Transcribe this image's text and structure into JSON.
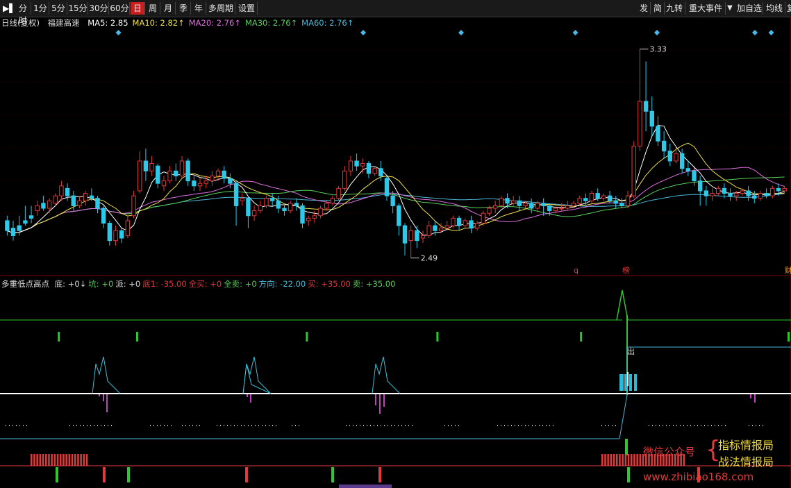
{
  "toolbar": {
    "icon": "expand-arrow-icon",
    "periods": [
      "分时",
      "1分",
      "5分",
      "15分",
      "30分",
      "60分",
      "日",
      "周",
      "月",
      "季",
      "年",
      "多周期",
      "设置"
    ],
    "active_period": "日",
    "right_buttons": [
      "发",
      "简",
      "九转",
      "重大事件",
      "加自选",
      "均线",
      "复"
    ]
  },
  "header": {
    "label": "日线(复权)",
    "name": "福建高速",
    "ma": [
      {
        "label": "MA5:",
        "value": "2.85",
        "color": "#ffffff",
        "arrow": ""
      },
      {
        "label": "MA10:",
        "value": "2.82",
        "color": "#f0e04a",
        "arrow": "↑"
      },
      {
        "label": "MA20:",
        "value": "2.76",
        "color": "#e070e0",
        "arrow": "↑"
      },
      {
        "label": "MA30:",
        "value": "2.76",
        "color": "#5ad05a",
        "arrow": "↑"
      },
      {
        "label": "MA60:",
        "value": "2.76",
        "color": "#4ab8d8",
        "arrow": "↑"
      }
    ]
  },
  "indicator": {
    "name": "多重低点高点",
    "segments": [
      {
        "text": "底: +0↓",
        "color": "#dddddd"
      },
      {
        "text": "坑: +0",
        "color": "#5ad05a"
      },
      {
        "text": "派: +0",
        "color": "#dddddd"
      },
      {
        "text": "底1: -35.00",
        "color": "#e03a3a"
      },
      {
        "text": "全买: +0",
        "color": "#e03a3a"
      },
      {
        "text": "全卖: +0",
        "color": "#5ad05a"
      },
      {
        "text": "方向: -22.00",
        "color": "#4ab8d8"
      },
      {
        "text": "买: +35.00",
        "color": "#e03a3a"
      },
      {
        "text": "卖: +35.00",
        "color": "#5ad05a"
      }
    ]
  },
  "chart_data": {
    "type": "candlestick",
    "price_high_label": "3.33",
    "price_low_label": "2.49",
    "marker_labels": [
      "q",
      "榜",
      "财"
    ],
    "indicator_glyph": "出",
    "ohlc": [
      [
        2.64,
        2.66,
        2.6,
        2.58
      ],
      [
        2.61,
        2.64,
        2.58,
        2.56
      ],
      [
        2.62,
        2.66,
        2.6,
        2.58
      ],
      [
        2.64,
        2.7,
        2.63,
        2.62
      ],
      [
        2.66,
        2.7,
        2.65,
        2.63
      ],
      [
        2.68,
        2.72,
        2.7,
        2.66
      ],
      [
        2.71,
        2.74,
        2.69,
        2.68
      ],
      [
        2.69,
        2.73,
        2.72,
        2.67
      ],
      [
        2.71,
        2.75,
        2.74,
        2.7
      ],
      [
        2.74,
        2.8,
        2.78,
        2.72
      ],
      [
        2.77,
        2.79,
        2.74,
        2.72
      ],
      [
        2.74,
        2.76,
        2.7,
        2.68
      ],
      [
        2.7,
        2.74,
        2.72,
        2.69
      ],
      [
        2.72,
        2.76,
        2.75,
        2.7
      ],
      [
        2.74,
        2.77,
        2.73,
        2.72
      ],
      [
        2.73,
        2.74,
        2.69,
        2.67
      ],
      [
        2.69,
        2.7,
        2.63,
        2.61
      ],
      [
        2.63,
        2.64,
        2.56,
        2.54
      ],
      [
        2.56,
        2.62,
        2.6,
        2.54
      ],
      [
        2.6,
        2.61,
        2.57,
        2.55
      ],
      [
        2.58,
        2.66,
        2.64,
        2.57
      ],
      [
        2.66,
        2.76,
        2.74,
        2.65
      ],
      [
        2.76,
        2.92,
        2.88,
        2.75
      ],
      [
        2.88,
        2.93,
        2.84,
        2.8
      ],
      [
        2.84,
        2.9,
        2.87,
        2.82
      ],
      [
        2.86,
        2.87,
        2.79,
        2.77
      ],
      [
        2.78,
        2.82,
        2.8,
        2.76
      ],
      [
        2.8,
        2.86,
        2.84,
        2.79
      ],
      [
        2.84,
        2.87,
        2.82,
        2.8
      ],
      [
        2.82,
        2.9,
        2.88,
        2.81
      ],
      [
        2.88,
        2.89,
        2.8,
        2.78
      ],
      [
        2.8,
        2.82,
        2.78,
        2.76
      ],
      [
        2.78,
        2.81,
        2.79,
        2.76
      ],
      [
        2.79,
        2.82,
        2.8,
        2.77
      ],
      [
        2.8,
        2.84,
        2.82,
        2.78
      ],
      [
        2.82,
        2.85,
        2.84,
        2.8
      ],
      [
        2.84,
        2.86,
        2.81,
        2.79
      ],
      [
        2.81,
        2.83,
        2.79,
        2.77
      ],
      [
        2.79,
        2.8,
        2.7,
        2.62
      ],
      [
        2.72,
        2.75,
        2.73,
        2.7
      ],
      [
        2.73,
        2.74,
        2.66,
        2.61
      ],
      [
        2.66,
        2.7,
        2.68,
        2.64
      ],
      [
        2.68,
        2.72,
        2.7,
        2.67
      ],
      [
        2.7,
        2.74,
        2.73,
        2.69
      ],
      [
        2.73,
        2.75,
        2.72,
        2.7
      ],
      [
        2.72,
        2.74,
        2.69,
        2.67
      ],
      [
        2.69,
        2.71,
        2.68,
        2.66
      ],
      [
        2.68,
        2.72,
        2.71,
        2.67
      ],
      [
        2.71,
        2.73,
        2.7,
        2.68
      ],
      [
        2.7,
        2.71,
        2.63,
        2.61
      ],
      [
        2.64,
        2.66,
        2.65,
        2.62
      ],
      [
        2.65,
        2.68,
        2.66,
        2.63
      ],
      [
        2.66,
        2.7,
        2.69,
        2.65
      ],
      [
        2.69,
        2.72,
        2.71,
        2.68
      ],
      [
        2.71,
        2.74,
        2.73,
        2.7
      ],
      [
        2.73,
        2.78,
        2.77,
        2.72
      ],
      [
        2.77,
        2.86,
        2.84,
        2.76
      ],
      [
        2.84,
        2.9,
        2.88,
        2.82
      ],
      [
        2.88,
        2.91,
        2.86,
        2.84
      ],
      [
        2.86,
        2.89,
        2.87,
        2.83
      ],
      [
        2.87,
        2.88,
        2.83,
        2.81
      ],
      [
        2.83,
        2.86,
        2.85,
        2.82
      ],
      [
        2.85,
        2.88,
        2.82,
        2.8
      ],
      [
        2.81,
        2.82,
        2.74,
        2.72
      ],
      [
        2.74,
        2.76,
        2.7,
        2.67
      ],
      [
        2.7,
        2.71,
        2.62,
        2.58
      ],
      [
        2.62,
        2.63,
        2.55,
        2.5
      ],
      [
        2.56,
        2.62,
        2.6,
        2.49
      ],
      [
        2.6,
        2.62,
        2.56,
        2.53
      ],
      [
        2.57,
        2.6,
        2.58,
        2.55
      ],
      [
        2.58,
        2.64,
        2.62,
        2.57
      ],
      [
        2.62,
        2.64,
        2.6,
        2.58
      ],
      [
        2.6,
        2.63,
        2.61,
        2.59
      ],
      [
        2.61,
        2.64,
        2.62,
        2.6
      ],
      [
        2.62,
        2.66,
        2.65,
        2.61
      ],
      [
        2.65,
        2.66,
        2.62,
        2.6
      ],
      [
        2.62,
        2.65,
        2.64,
        2.61
      ],
      [
        2.64,
        2.66,
        2.61,
        2.59
      ],
      [
        2.61,
        2.64,
        2.63,
        2.6
      ],
      [
        2.63,
        2.68,
        2.67,
        2.62
      ],
      [
        2.67,
        2.7,
        2.69,
        2.66
      ],
      [
        2.69,
        2.72,
        2.7,
        2.67
      ],
      [
        2.7,
        2.74,
        2.73,
        2.69
      ],
      [
        2.73,
        2.75,
        2.71,
        2.69
      ],
      [
        2.71,
        2.74,
        2.72,
        2.7
      ],
      [
        2.72,
        2.74,
        2.7,
        2.68
      ],
      [
        2.7,
        2.72,
        2.71,
        2.69
      ],
      [
        2.71,
        2.73,
        2.69,
        2.67
      ],
      [
        2.69,
        2.72,
        2.71,
        2.68
      ],
      [
        2.71,
        2.73,
        2.7,
        2.66
      ],
      [
        2.7,
        2.71,
        2.68,
        2.66
      ],
      [
        2.68,
        2.7,
        2.69,
        2.67
      ],
      [
        2.69,
        2.71,
        2.69,
        2.68
      ],
      [
        2.69,
        2.72,
        2.7,
        2.68
      ],
      [
        2.7,
        2.72,
        2.71,
        2.69
      ],
      [
        2.71,
        2.74,
        2.73,
        2.7
      ],
      [
        2.73,
        2.75,
        2.72,
        2.7
      ],
      [
        2.72,
        2.76,
        2.75,
        2.71
      ],
      [
        2.75,
        2.77,
        2.73,
        2.72
      ],
      [
        2.73,
        2.75,
        2.74,
        2.72
      ],
      [
        2.74,
        2.76,
        2.72,
        2.71
      ],
      [
        2.72,
        2.74,
        2.71,
        2.69
      ],
      [
        2.71,
        2.73,
        2.7,
        2.69
      ],
      [
        2.7,
        2.76,
        2.74,
        2.69
      ],
      [
        2.74,
        2.96,
        2.94,
        2.73
      ],
      [
        2.94,
        3.33,
        3.12,
        2.92
      ],
      [
        3.12,
        3.28,
        3.08,
        3.0
      ],
      [
        3.08,
        3.14,
        3.02,
        2.98
      ],
      [
        3.02,
        3.06,
        2.96,
        2.94
      ],
      [
        2.96,
        3.0,
        2.92,
        2.89
      ],
      [
        2.92,
        2.95,
        2.88,
        2.86
      ],
      [
        2.88,
        2.94,
        2.91,
        2.87
      ],
      [
        2.91,
        2.93,
        2.85,
        2.83
      ],
      [
        2.85,
        2.88,
        2.84,
        2.82
      ],
      [
        2.84,
        2.86,
        2.8,
        2.78
      ],
      [
        2.8,
        2.82,
        2.76,
        2.7
      ],
      [
        2.76,
        2.78,
        2.74,
        2.7
      ],
      [
        2.74,
        2.77,
        2.75,
        2.72
      ],
      [
        2.75,
        2.78,
        2.77,
        2.74
      ],
      [
        2.77,
        2.79,
        2.75,
        2.73
      ],
      [
        2.75,
        2.77,
        2.74,
        2.72
      ],
      [
        2.74,
        2.76,
        2.75,
        2.72
      ],
      [
        2.75,
        2.77,
        2.76,
        2.74
      ],
      [
        2.76,
        2.78,
        2.74,
        2.72
      ],
      [
        2.74,
        2.76,
        2.73,
        2.71
      ],
      [
        2.73,
        2.76,
        2.75,
        2.72
      ],
      [
        2.75,
        2.77,
        2.74,
        2.73
      ],
      [
        2.74,
        2.78,
        2.77,
        2.73
      ],
      [
        2.77,
        2.79,
        2.76,
        2.74
      ],
      [
        2.76,
        2.78,
        2.77,
        2.75
      ]
    ],
    "diamond_markers": [
      7,
      22,
      28,
      35,
      40,
      46,
      47
    ],
    "green_ticks": [
      4,
      10,
      23,
      33,
      44,
      57
    ],
    "cyan_peaks": [
      [
        7,
        1.0
      ],
      [
        18,
        0.85
      ],
      [
        28,
        1.55
      ]
    ],
    "magenta_dips": [
      7,
      8,
      18,
      28,
      29,
      57
    ],
    "red_bars_1": [
      [
        2,
        6
      ]
    ],
    "red_bars_2": [
      [
        45,
        52
      ]
    ],
    "bottom_green_marks": [
      4,
      9,
      24,
      47
    ],
    "bottom_red_marks": [
      7,
      18,
      28,
      52
    ]
  },
  "colors": {
    "up": "#e03a3a",
    "down": "#2ec8e8",
    "ma5": "#ffffff",
    "ma10": "#f0e04a",
    "ma20": "#e070e0",
    "ma30": "#5ad05a",
    "ma60": "#4ab8d8"
  },
  "watermark": {
    "line1_left": "微信公众号",
    "line1_right": "指标情报局",
    "line2_right": "战法情报局",
    "url": "www.zhibiao168.com"
  }
}
